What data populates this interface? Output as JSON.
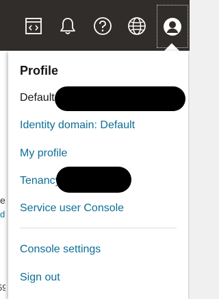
{
  "topbar": {
    "icons": [
      {
        "name": "code-editor-icon"
      },
      {
        "name": "bell-icon"
      },
      {
        "name": "help-icon"
      },
      {
        "name": "globe-icon"
      },
      {
        "name": "user-profile-icon"
      }
    ]
  },
  "background": {
    "fragment_e": "e",
    "fragment_d": "d",
    "fragment_num": "59"
  },
  "profile_menu": {
    "title": "Profile",
    "tenancy_label": "Default",
    "items": [
      {
        "label": "Identity domain: Default"
      },
      {
        "label": "My profile"
      },
      {
        "label": "Tenancy"
      },
      {
        "label": "Service user Console"
      },
      {
        "label": "Console settings"
      },
      {
        "label": "Sign out"
      }
    ]
  },
  "colors": {
    "topbar_bg": "#312d2a",
    "link": "#0d6e96",
    "text": "#161513"
  }
}
